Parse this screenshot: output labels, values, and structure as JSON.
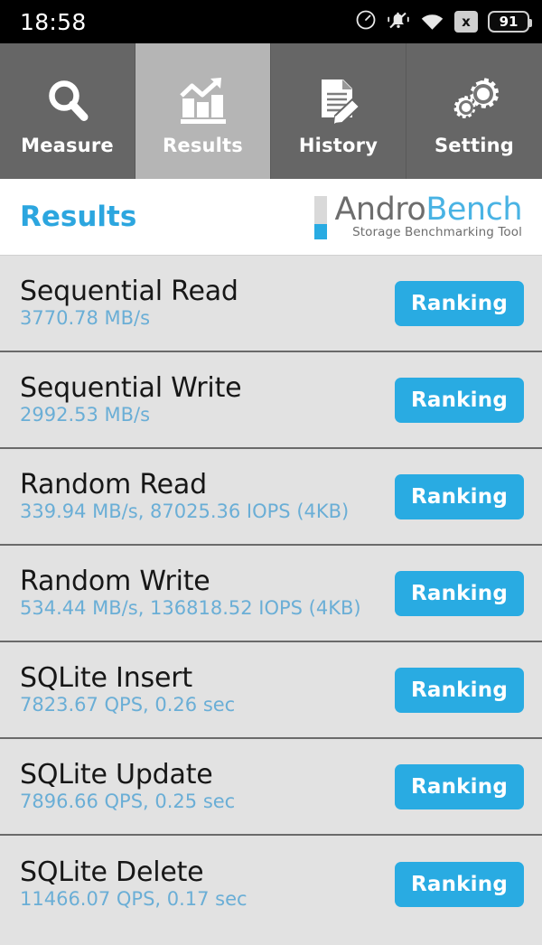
{
  "statusbar": {
    "time": "18:58",
    "battery_level": "91",
    "icons": [
      "speedometer-icon",
      "bell-muted-icon",
      "wifi-icon",
      "x-badge-icon",
      "battery-icon"
    ],
    "x_badge_label": "x"
  },
  "tabs": [
    {
      "label": "Measure",
      "icon": "magnifier-icon",
      "active": false
    },
    {
      "label": "Results",
      "icon": "bar-chart-trend-icon",
      "active": true
    },
    {
      "label": "History",
      "icon": "document-pencil-icon",
      "active": false
    },
    {
      "label": "Setting",
      "icon": "gears-icon",
      "active": false
    }
  ],
  "header": {
    "title": "Results",
    "logo_primary": "Andro",
    "logo_secondary": "Bench",
    "logo_tagline": "Storage Benchmarking Tool"
  },
  "results": [
    {
      "title": "Sequential Read",
      "value": "3770.78 MB/s",
      "button": "Ranking"
    },
    {
      "title": "Sequential Write",
      "value": "2992.53 MB/s",
      "button": "Ranking"
    },
    {
      "title": "Random Read",
      "value": "339.94 MB/s, 87025.36 IOPS (4KB)",
      "button": "Ranking"
    },
    {
      "title": "Random Write",
      "value": "534.44 MB/s, 136818.52 IOPS (4KB)",
      "button": "Ranking"
    },
    {
      "title": "SQLite Insert",
      "value": "7823.67 QPS, 0.26 sec",
      "button": "Ranking"
    },
    {
      "title": "SQLite Update",
      "value": "7896.66 QPS, 0.25 sec",
      "button": "Ranking"
    },
    {
      "title": "SQLite Delete",
      "value": "11466.07 QPS, 0.17 sec",
      "button": "Ranking"
    }
  ],
  "colors": {
    "accent_blue": "#29abe2",
    "value_blue": "#6aaed6",
    "row_bg": "#e2e2e2",
    "tab_inactive": "#666666",
    "tab_active": "#b5b5b5"
  }
}
